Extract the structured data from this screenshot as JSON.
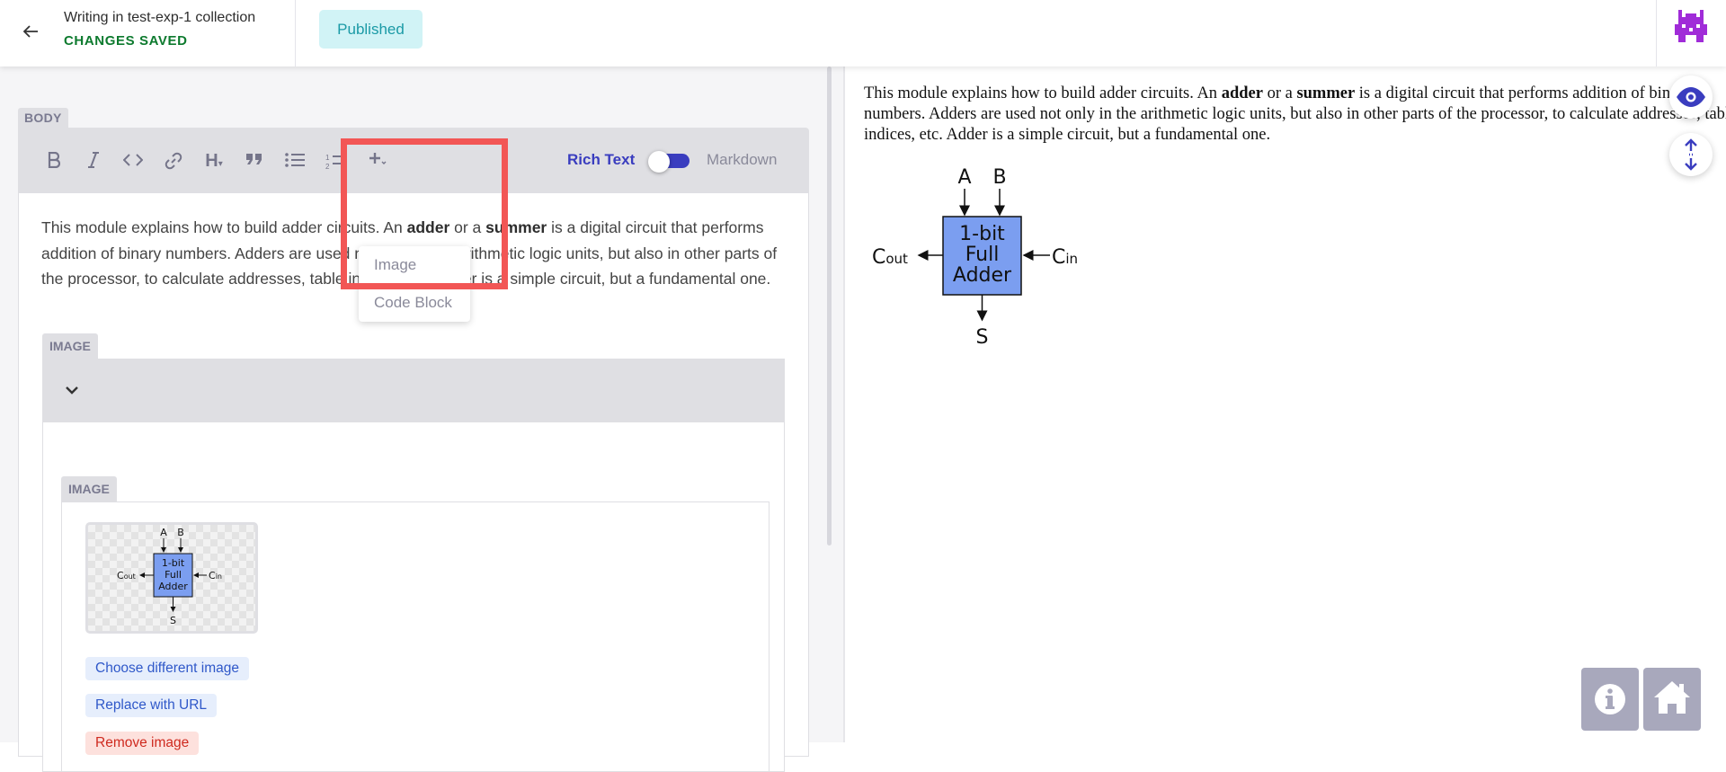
{
  "header": {
    "back_icon": "arrow-left-icon",
    "collection_title": "Writing in test-exp-1 collection",
    "save_status": "CHANGES SAVED",
    "publish_status": "Published",
    "avatar_icon": "pixel-avatar-icon",
    "colors": {
      "saved": "#0d7a2e",
      "published_bg": "#d1f3f6",
      "published_text": "#1b9aa6",
      "avatar": "#a02cd8"
    }
  },
  "editor": {
    "body_label": "BODY",
    "toolbar": {
      "buttons": [
        "bold-icon",
        "italic-icon",
        "code-icon",
        "link-icon",
        "heading-icon",
        "quote-icon",
        "bullet-list-icon",
        "numbered-list-icon",
        "plus-icon"
      ],
      "heading_glyph": "H",
      "rich_text_label": "Rich Text",
      "markdown_label": "Markdown"
    },
    "insert_menu": {
      "items": [
        "Image",
        "Code Block"
      ]
    },
    "body": {
      "part1": "This module explains how to build adder circuits. An ",
      "bold1": "adder",
      "part2": " or a ",
      "bold2": "summer",
      "part3": " is a digital circuit that performs addition of binary numbers. Adders are used not only in the arithmetic logic units, but also in other parts of the processor, to calculate addresses, table indices, etc. Adder is a simple circuit, but a fundamental one."
    },
    "image_block": {
      "label": "IMAGE",
      "inner_label": "IMAGE",
      "actions": {
        "choose": "Choose different image",
        "replace": "Replace with URL",
        "remove": "Remove image"
      }
    }
  },
  "diagram": {
    "input_a": "A",
    "input_b": "B",
    "box_line1": "1-bit",
    "box_line2": "Full",
    "box_line3": "Adder",
    "carry_out": "C",
    "carry_out_sub": "out",
    "carry_in": "C",
    "carry_in_sub": "in",
    "sum": "S",
    "box_color": "#7b9ef0"
  },
  "preview": {
    "part1": "This module explains how to build adder circuits. An ",
    "bold1": "adder",
    "part2": " or a ",
    "bold2": "summer",
    "part3": " is a digital circuit that performs addition of binary numbers. Adders are used not only in the arithmetic logic units, but also in other parts of the processor, to calculate addresses, table indices, etc. Adder is a simple circuit, but a fundamental one.",
    "fab_icons": [
      "eye-icon",
      "expand-vertical-icon"
    ],
    "corner_buttons": [
      "info-icon",
      "home-icon"
    ],
    "accent": "#3a3dbf"
  }
}
